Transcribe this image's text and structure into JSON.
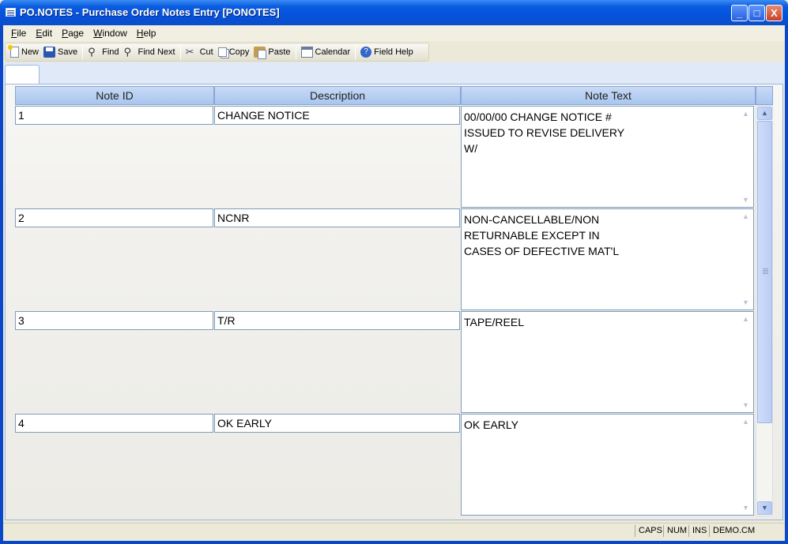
{
  "window": {
    "title": "PO.NOTES - Purchase Order Notes Entry [PONOTES]",
    "controls": {
      "minimize": "_",
      "maximize": "□",
      "close": "X"
    }
  },
  "menu": [
    {
      "label": "File",
      "mnemonic": "F"
    },
    {
      "label": "Edit",
      "mnemonic": "E"
    },
    {
      "label": "Page",
      "mnemonic": "P"
    },
    {
      "label": "Window",
      "mnemonic": "W"
    },
    {
      "label": "Help",
      "mnemonic": "H"
    }
  ],
  "toolbar": {
    "new": "New",
    "save": "Save",
    "find": "Find",
    "find_next": "Find Next",
    "cut": "Cut",
    "copy": "Copy",
    "paste": "Paste",
    "calendar": "Calendar",
    "field_help": "Field Help"
  },
  "grid": {
    "headers": {
      "note_id": "Note ID",
      "description": "Description",
      "note_text": "Note Text"
    },
    "rows": [
      {
        "note_id": "1",
        "description": "CHANGE NOTICE",
        "note_text": "00/00/00 CHANGE NOTICE #\nISSUED TO REVISE DELIVERY\nW/"
      },
      {
        "note_id": "2",
        "description": "NCNR",
        "note_text": "NON-CANCELLABLE/NON\nRETURNABLE EXCEPT IN\nCASES OF DEFECTIVE MAT'L"
      },
      {
        "note_id": "3",
        "description": "T/R",
        "note_text": "TAPE/REEL"
      },
      {
        "note_id": "4",
        "description": "OK EARLY",
        "note_text": "OK EARLY"
      }
    ]
  },
  "status": {
    "caps": "CAPS",
    "num": "NUM",
    "ins": "INS",
    "account": "DEMO.CM"
  }
}
